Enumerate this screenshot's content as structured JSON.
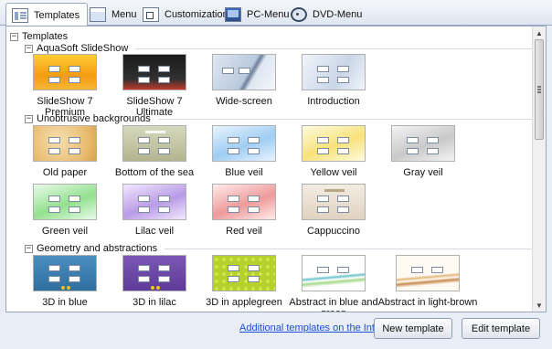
{
  "tabs": [
    {
      "label": "Templates",
      "icon": "templates-icon",
      "active": true
    },
    {
      "label": "Menu",
      "icon": "menu-icon",
      "active": false
    },
    {
      "label": "Customization",
      "icon": "customization-icon",
      "active": false
    },
    {
      "label": "PC-Menu",
      "icon": "pc-menu-icon",
      "active": false
    },
    {
      "label": "DVD-Menu",
      "icon": "dvd-icon",
      "active": false
    }
  ],
  "tree": {
    "root_label": "Templates",
    "root_toggle": "−",
    "groups": [
      {
        "label": "AquaSoft SlideShow",
        "toggle": "−",
        "items": [
          {
            "label": "SlideShow 7 Premium",
            "style": "premium"
          },
          {
            "label": "SlideShow 7 Ultimate",
            "style": "ultimate"
          },
          {
            "label": "Wide-screen",
            "style": "wide"
          },
          {
            "label": "Introduction",
            "style": "intro"
          }
        ]
      },
      {
        "label": "Unobtrusive backgrounds",
        "toggle": "−",
        "items": [
          {
            "label": "Old paper",
            "style": "oldpaper"
          },
          {
            "label": "Bottom of the sea",
            "style": "sea"
          },
          {
            "label": "Blue veil",
            "style": "blueveil"
          },
          {
            "label": "Yellow veil",
            "style": "yellowveil"
          },
          {
            "label": "Gray veil",
            "style": "grayveil"
          },
          {
            "label": "Green veil",
            "style": "greenveil"
          },
          {
            "label": "Lilac veil",
            "style": "lilacveil"
          },
          {
            "label": "Red veil",
            "style": "redveil"
          },
          {
            "label": "Cappuccino",
            "style": "cappuccino"
          }
        ]
      },
      {
        "label": "Geometry and abstractions",
        "toggle": "−",
        "items": [
          {
            "label": "3D in blue",
            "style": "d3blue"
          },
          {
            "label": "3D in lilac",
            "style": "d3lilac"
          },
          {
            "label": "3D in applegreen",
            "style": "d3green"
          },
          {
            "label": "Abstract in blue and green",
            "style": "absblue"
          },
          {
            "label": "Abstract in light-brown",
            "style": "absbrown"
          }
        ]
      }
    ]
  },
  "footer": {
    "link_label": "Additional templates on the Internet",
    "new_template_label": "New template",
    "edit_template_label": "Edit template"
  },
  "colors": {
    "link": "#1a4fd6",
    "panel_border": "#9aa9c2",
    "window_bg": "#e9eef6"
  }
}
